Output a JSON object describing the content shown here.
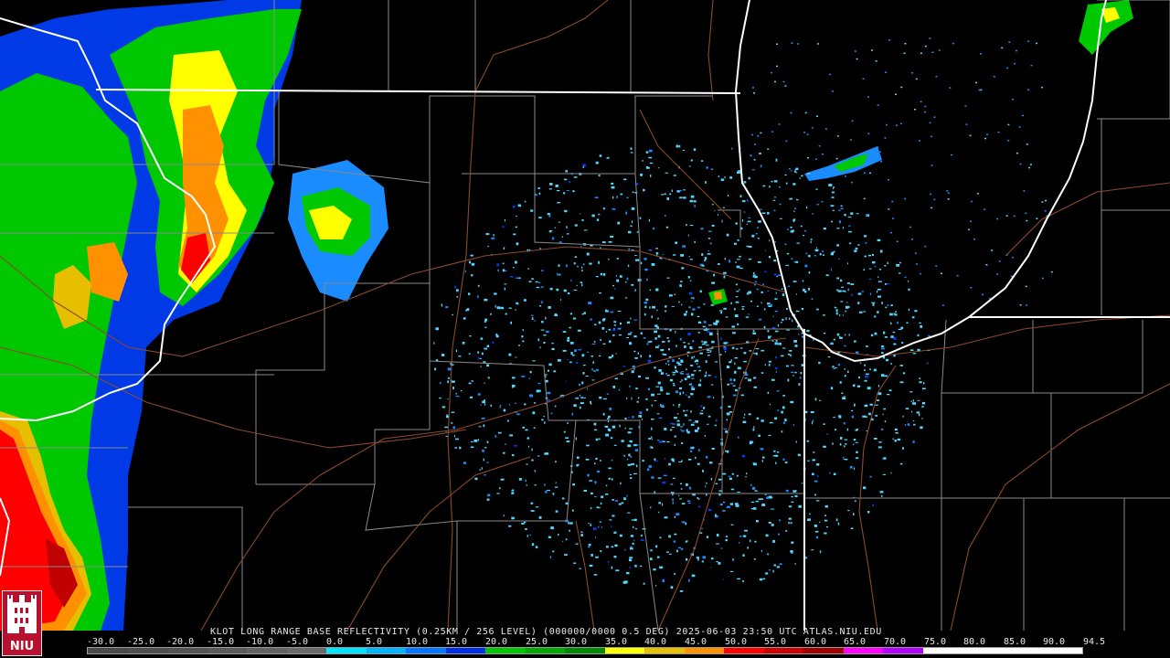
{
  "product": {
    "caption": "KLOT LONG RANGE BASE REFLECTIVITY (0.25KM / 256 LEVEL) (000000/0000 0.5 DEG) 2025-06-03 23:50 UTC  ATLAS.NIU.EDU"
  },
  "legend": {
    "ticks": [
      "-30.0",
      "-25.0",
      "-20.0",
      "-15.0",
      "-10.0",
      "-5.0",
      "0.0",
      "5.0",
      "10.0",
      "15.0",
      "20.0",
      "25.0",
      "30.0",
      "35.0",
      "40.0",
      "45.0",
      "50.0",
      "55.0",
      "60.0",
      "65.0",
      "70.0",
      "75.0",
      "80.0",
      "85.0",
      "90.0",
      "94.5"
    ],
    "colors": [
      "#4a4a4a",
      "#4e4e4e",
      "#535353",
      "#5a5a5a",
      "#626262",
      "#6a6a6a",
      "#00e6ff",
      "#00b4ff",
      "#0078ff",
      "#0030e6",
      "#00c800",
      "#00aa00",
      "#008a00",
      "#ffff00",
      "#e6c000",
      "#ff9000",
      "#ff0000",
      "#d00000",
      "#a00000",
      "#ff00ff",
      "#b400ff",
      "#ffffff",
      "#ffffff",
      "#ffffff",
      "#ffffff"
    ]
  },
  "logo": {
    "text": "NIU",
    "icon": "niu-castle-logo"
  },
  "map": {
    "state_border_color": "#ffffff",
    "county_border_color": "#8a8a8a",
    "highway_color": "#8b4a2a",
    "palette": {
      "light_blue": "#55d6ff",
      "mid_blue": "#1a8cff",
      "deep_blue": "#0040ff",
      "green": "#00c800",
      "dark_green": "#008a00",
      "yellow": "#ffff00",
      "orange": "#ff9000",
      "red": "#ff0000",
      "dark_red": "#c00000"
    }
  }
}
